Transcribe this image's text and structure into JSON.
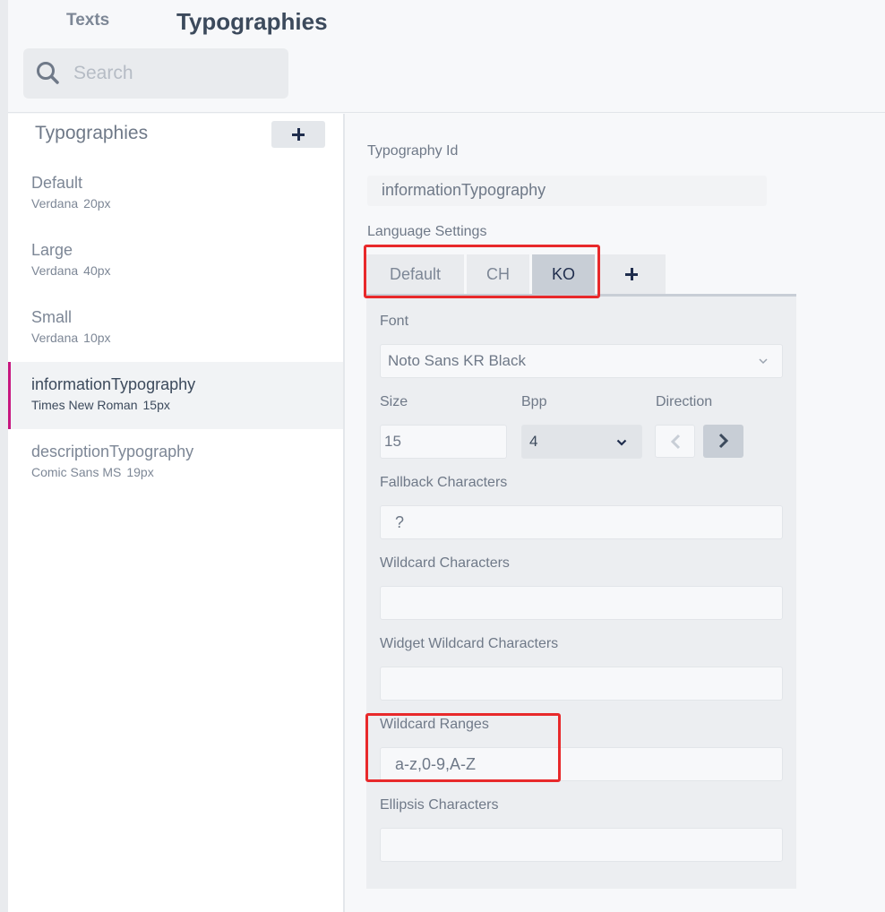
{
  "header": {
    "tab_texts": "Texts",
    "tab_typographies": "Typographies",
    "search_placeholder": "Search"
  },
  "sidebar": {
    "title": "Typographies",
    "items": [
      {
        "name": "Default",
        "font": "Verdana",
        "size": "20px"
      },
      {
        "name": "Large",
        "font": "Verdana",
        "size": "40px"
      },
      {
        "name": "Small",
        "font": "Verdana",
        "size": "10px"
      },
      {
        "name": "informationTypography",
        "font": "Times New Roman",
        "size": "15px"
      },
      {
        "name": "descriptionTypography",
        "font": "Comic Sans MS",
        "size": "19px"
      }
    ]
  },
  "detail": {
    "typography_id_label": "Typography Id",
    "typography_id_value": "informationTypography",
    "language_settings_label": "Language Settings",
    "language_tabs": [
      "Default",
      "CH",
      "KO"
    ],
    "active_language": "KO",
    "font_label": "Font",
    "font_value": "Noto Sans KR Black",
    "size_label": "Size",
    "size_value": "15",
    "bpp_label": "Bpp",
    "bpp_value": "4",
    "direction_label": "Direction",
    "fallback_label": "Fallback Characters",
    "fallback_value": "?",
    "wildcard_label": "Wildcard Characters",
    "wildcard_value": "",
    "widget_wildcard_label": "Widget Wildcard Characters",
    "widget_wildcard_value": "",
    "wildcard_ranges_label": "Wildcard Ranges",
    "wildcard_ranges_value": "a-z,0-9,A-Z",
    "ellipsis_label": "Ellipsis Characters",
    "ellipsis_value": ""
  },
  "colors": {
    "accent_selected": "#c7167f",
    "highlight_box": "#e8292b",
    "active_tab": "#c8ced6"
  }
}
